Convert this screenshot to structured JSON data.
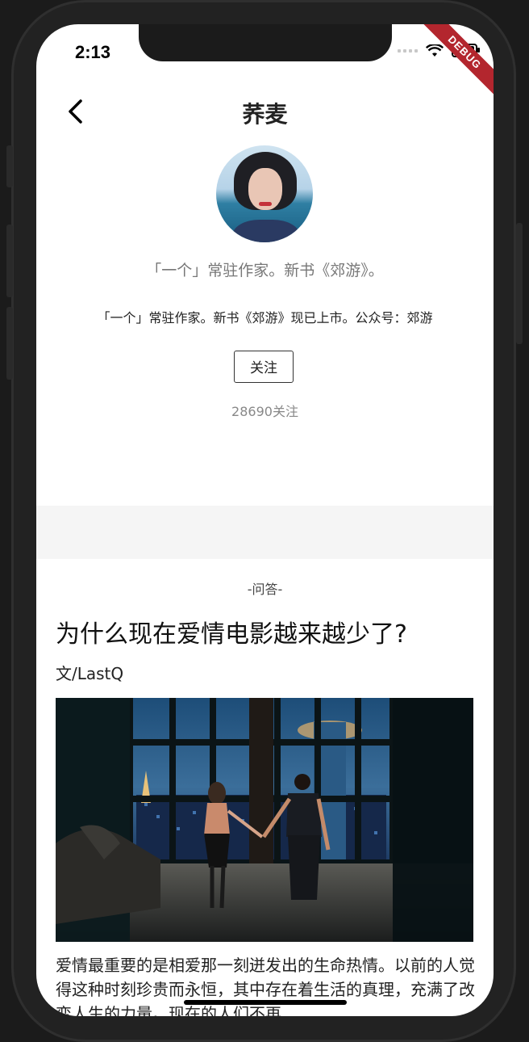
{
  "status_bar": {
    "time": "2:13"
  },
  "debug_banner": "DEBUG",
  "nav": {
    "title": "荞麦"
  },
  "profile": {
    "subtitle": "「一个」常驻作家。新书《郊游》。",
    "intro": "「一个」常驻作家。新书《郊游》现已上市。公众号：郊游",
    "follow_label": "关注",
    "follow_count": "28690关注"
  },
  "article": {
    "section_tag": "-问答-",
    "title": "为什么现在爱情电影越来越少了?",
    "author": "文/LastQ",
    "body": "爱情最重要的是相爱那一刻迸发出的生命热情。以前的人觉得这种时刻珍贵而永恒，其中存在着生活的真理，充满了改变人生的力量。现在的人们不再"
  },
  "colors": {
    "accent_debug": "#b3262e",
    "band": "#f5f5f5"
  }
}
